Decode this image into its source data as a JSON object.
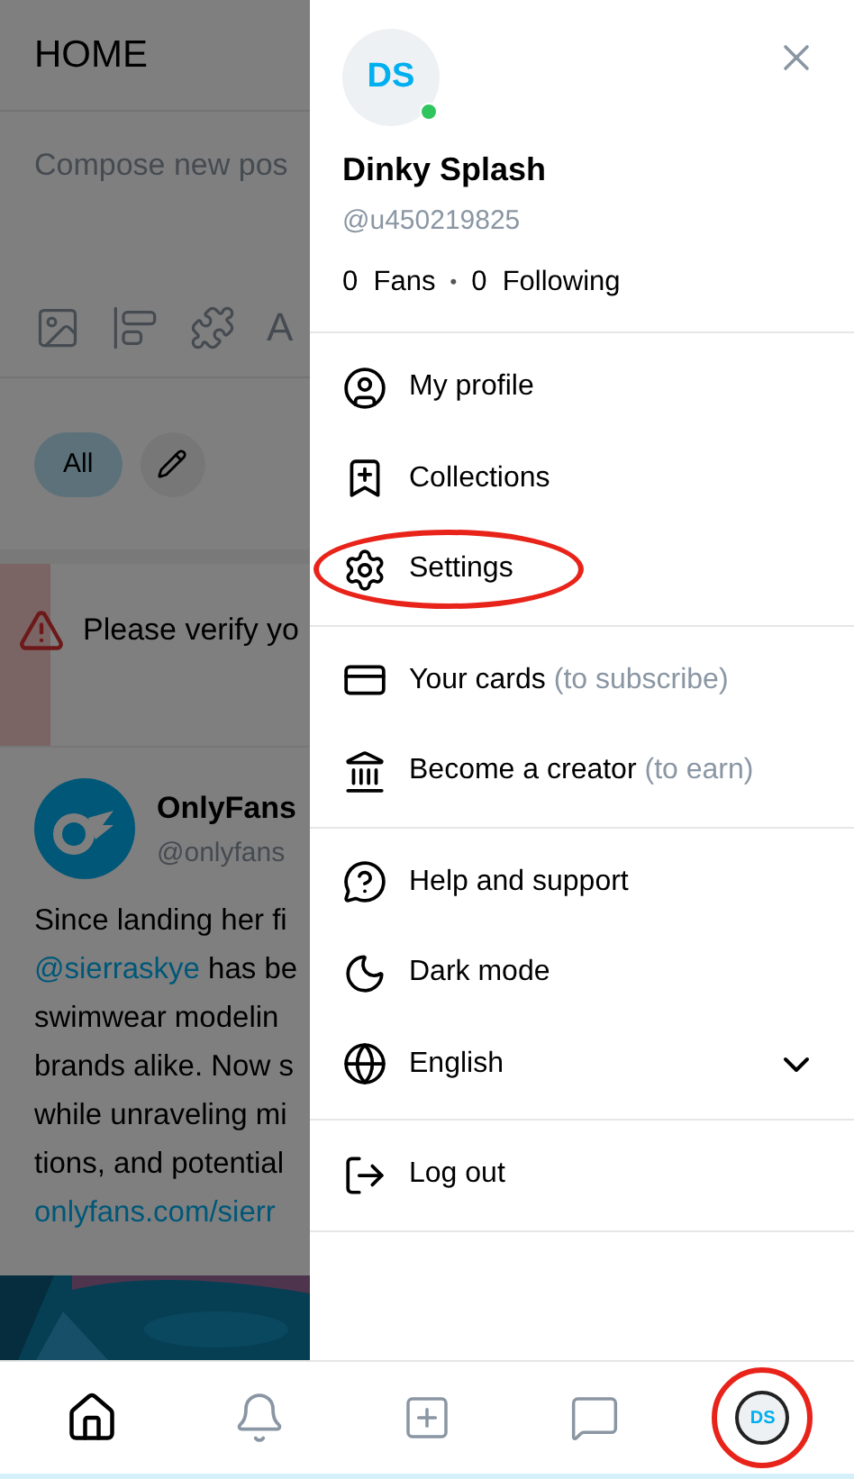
{
  "feed": {
    "title": "HOME",
    "compose": {
      "placeholder": "Compose new pos"
    },
    "format_label": "A",
    "chips": [
      {
        "label": "All",
        "selected": true
      }
    ],
    "warning": "Please verify yo",
    "post": {
      "author": "OnlyFans",
      "handle": "@onlyfans",
      "lines": [
        [
          {
            "kind": "text",
            "text": "Since landing her fi"
          }
        ],
        [
          {
            "kind": "link",
            "text": "@sierraskye"
          },
          {
            "kind": "text",
            "text": " has be"
          }
        ],
        [
          {
            "kind": "text",
            "text": "swimwear modelin"
          }
        ],
        [
          {
            "kind": "text",
            "text": "brands alike. Now s"
          }
        ],
        [
          {
            "kind": "text",
            "text": "while unraveling mi"
          }
        ],
        [
          {
            "kind": "text",
            "text": "tions, and potential"
          }
        ],
        [
          {
            "kind": "link",
            "text": "onlyfans.com/sierr"
          }
        ]
      ],
      "media": {
        "kind": "picture"
      }
    }
  },
  "drawer": {
    "avatar": "DS",
    "online": true,
    "name": "Dinky Splash",
    "handle": "@u450219825",
    "stats": [
      {
        "count": "0",
        "label": "Fans"
      },
      {
        "count": "0",
        "label": "Following"
      }
    ],
    "separator": "•",
    "sections": [
      [
        {
          "label": "My profile",
          "highlighted": false
        },
        {
          "label": "Collections",
          "highlighted": false
        },
        {
          "label": "Settings",
          "highlighted": true
        }
      ],
      [
        {
          "label": "Your cards",
          "hint": "(to subscribe)",
          "highlighted": false
        },
        {
          "label": "Become a creator",
          "hint": "(to earn)",
          "highlighted": false
        }
      ],
      [
        {
          "label": "Help and support",
          "highlighted": false
        },
        {
          "label": "Dark mode",
          "highlighted": false
        },
        {
          "label": "English",
          "dropdown": true,
          "highlighted": false
        }
      ],
      [
        {
          "label": "Log out",
          "highlighted": false
        }
      ]
    ]
  },
  "bottom_nav": [
    {
      "kind": "home",
      "selected": true,
      "highlighted": false
    },
    {
      "kind": "bell",
      "selected": false,
      "highlighted": false
    },
    {
      "kind": "add",
      "selected": false,
      "highlighted": false
    },
    {
      "kind": "messages",
      "selected": false,
      "highlighted": false
    },
    {
      "kind": "avatar",
      "label": "DS",
      "selected": false,
      "highlighted": true
    }
  ]
}
